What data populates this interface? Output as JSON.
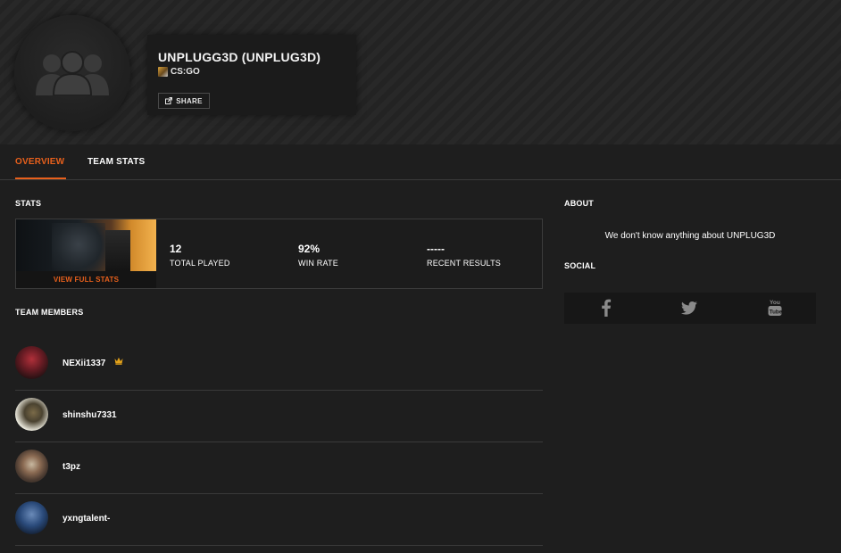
{
  "team": {
    "name": "UNPLUGG3D (UNPLUG3D)",
    "game": "CS:GO",
    "share_label": "SHARE",
    "avatar_icon": "team-group-icon"
  },
  "tabs": [
    {
      "label": "OVERVIEW",
      "active": true
    },
    {
      "label": "TEAM STATS",
      "active": false
    }
  ],
  "stats": {
    "heading": "STATS",
    "view_full_label": "VIEW FULL STATS",
    "items": [
      {
        "value": "12",
        "label": "TOTAL PLAYED"
      },
      {
        "value": "92%",
        "label": "WIN RATE"
      },
      {
        "value": "-----",
        "label": "RECENT RESULTS"
      }
    ]
  },
  "members": {
    "heading": "TEAM MEMBERS",
    "list": [
      {
        "name": "NEXii1337",
        "captain": true
      },
      {
        "name": "shinshu7331",
        "captain": false
      },
      {
        "name": "t3pz",
        "captain": false
      },
      {
        "name": "yxngtalent-",
        "captain": false
      }
    ]
  },
  "about": {
    "heading": "ABOUT",
    "text": "We don't know anything about UNPLUG3D"
  },
  "social": {
    "heading": "SOCIAL",
    "icons": [
      "facebook-icon",
      "twitter-icon",
      "youtube-icon"
    ]
  },
  "colors": {
    "accent": "#e8601c",
    "background": "#1e1e1e",
    "crown": "#e3a21a"
  }
}
